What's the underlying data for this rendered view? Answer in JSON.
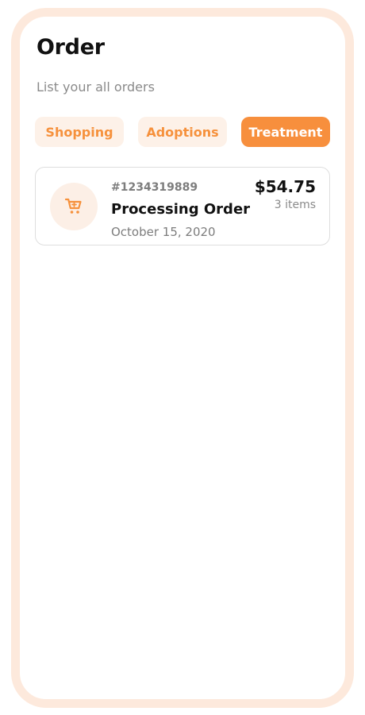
{
  "header": {
    "title": "Order",
    "subtitle": "List your all orders"
  },
  "tabs": [
    {
      "label": "Shopping",
      "active": false
    },
    {
      "label": "Adoptions",
      "active": false
    },
    {
      "label": "Treatment",
      "active": true
    }
  ],
  "orders": [
    {
      "id": "#1234319889",
      "status": "Processing Order",
      "date": "October 15, 2020",
      "price": "$54.75",
      "items": "3 items",
      "icon": "shopping-cart-icon"
    }
  ],
  "colors": {
    "accent": "#f78f3d",
    "accent_light": "#fdf1e8",
    "frame": "#fde9dc"
  }
}
